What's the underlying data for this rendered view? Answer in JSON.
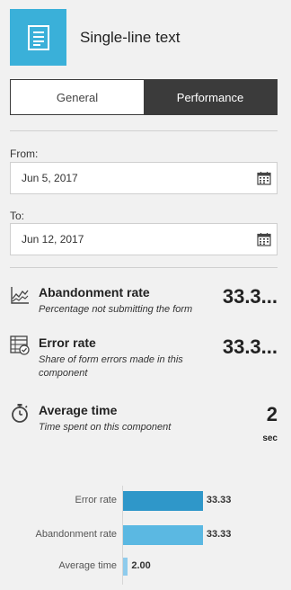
{
  "header": {
    "title": "Single-line text",
    "icon": "text-field-icon",
    "icon_bg": "#3ab0d9"
  },
  "tabs": [
    {
      "label": "General",
      "active": false
    },
    {
      "label": "Performance",
      "active": true
    }
  ],
  "date_range": {
    "from_label": "From:",
    "from_value": "Jun 5, 2017",
    "to_label": "To:",
    "to_value": "Jun 12, 2017",
    "calendar_icon": "calendar-icon"
  },
  "metrics": [
    {
      "title": "Abandonment rate",
      "subtitle": "Percentage not submitting the form",
      "value": "33.3...",
      "unit": "",
      "icon": "line-chart-icon"
    },
    {
      "title": "Error rate",
      "subtitle": "Share of form errors made in this component",
      "value": "33.3...",
      "unit": "",
      "icon": "error-grid-icon"
    },
    {
      "title": "Average time",
      "subtitle": "Time spent on this component",
      "value": "2",
      "unit": "sec",
      "icon": "stopwatch-icon"
    }
  ],
  "chart_data": {
    "type": "bar",
    "orientation": "horizontal",
    "categories": [
      "Error rate",
      "Abandonment rate",
      "Average time"
    ],
    "values": [
      33.33,
      33.33,
      2.0
    ],
    "value_labels": [
      "33.33",
      "33.33",
      "2.00"
    ],
    "colors": [
      "#2f97c9",
      "#5bb8e2",
      "#8ecbec"
    ],
    "xlim": [
      0,
      60
    ],
    "title": "",
    "xlabel": "",
    "ylabel": ""
  }
}
